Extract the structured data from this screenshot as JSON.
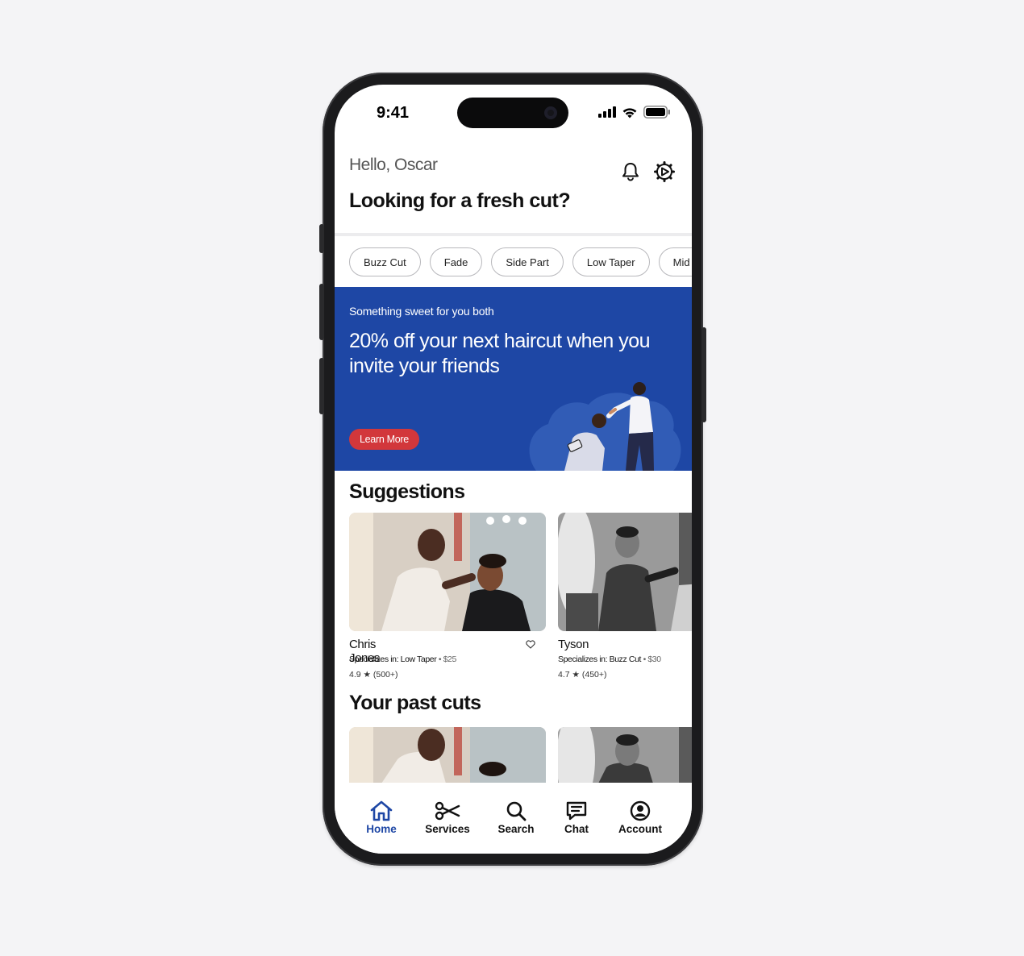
{
  "status_bar": {
    "time": "9:41"
  },
  "header": {
    "greeting": "Hello, Oscar",
    "headline": "Looking for a fresh cut?",
    "icons": [
      "bell-icon",
      "settings-gear-icon"
    ]
  },
  "chips": [
    "Buzz Cut",
    "Fade",
    "Side Part",
    "Low Taper",
    "Mid Fade"
  ],
  "promo": {
    "eyebrow": "Something sweet for you both",
    "title": "20% off your next haircut when you invite your friends",
    "button_label": "Learn More",
    "colors": {
      "background": "#1e47a5",
      "button": "#d2373b"
    }
  },
  "suggestions": {
    "title": "Suggestions",
    "cards": [
      {
        "name": "Chris Jones",
        "specialty": "Specializes in: Low Taper",
        "price": "• $25",
        "rating": "4.9",
        "reviews": "(500+)"
      },
      {
        "name": "Tyson",
        "specialty": "Specializes in: Buzz Cut",
        "price": "• $30",
        "rating": "4.7",
        "reviews": "(450+)"
      }
    ]
  },
  "past_cuts": {
    "title": "Your past cuts"
  },
  "tabbar": {
    "active_color": "#1e47a5",
    "items": [
      {
        "label": "Home",
        "icon": "home-icon"
      },
      {
        "label": "Services",
        "icon": "scissors-icon"
      },
      {
        "label": "Search",
        "icon": "search-icon"
      },
      {
        "label": "Chat",
        "icon": "chat-icon"
      },
      {
        "label": "Account",
        "icon": "account-icon"
      }
    ]
  }
}
